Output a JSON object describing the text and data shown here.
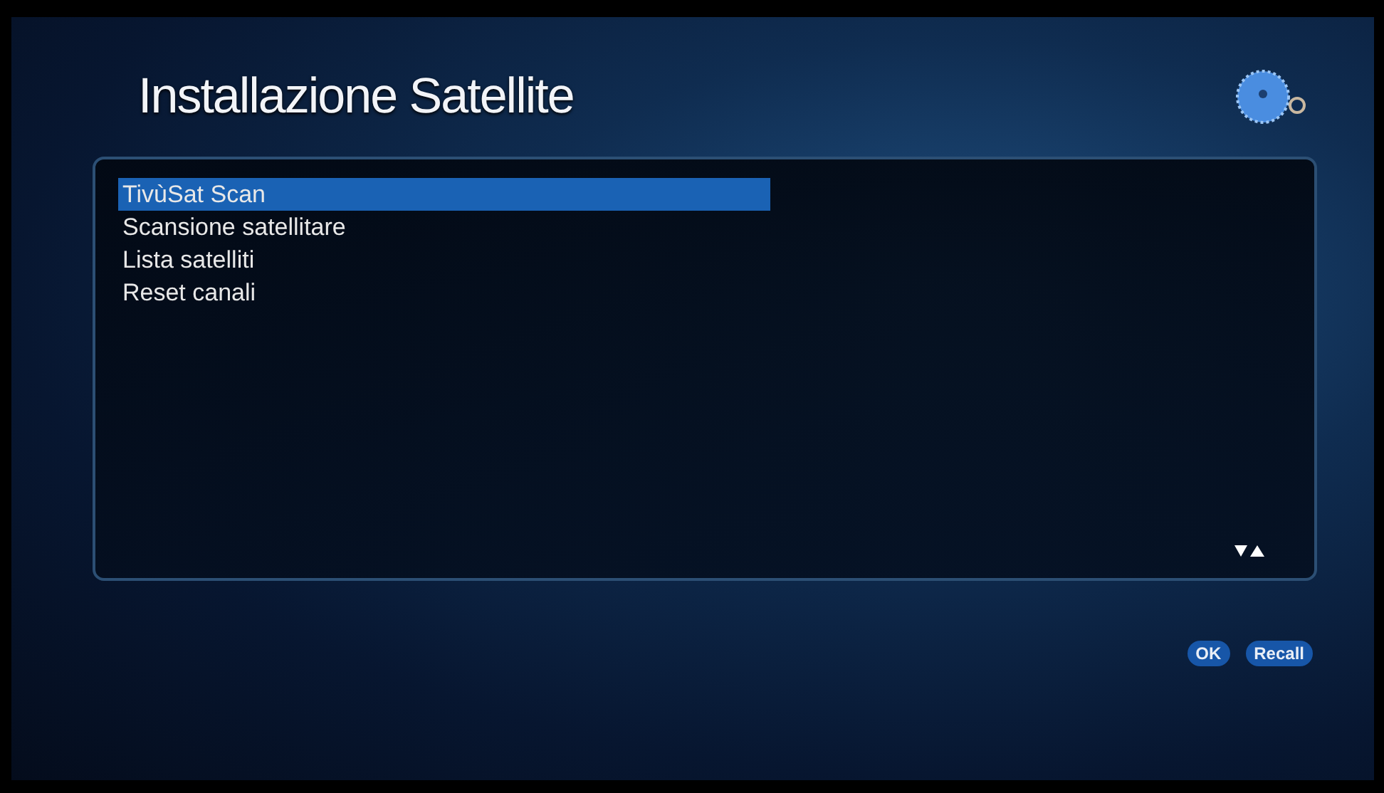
{
  "title": "Installazione Satellite",
  "menu": [
    {
      "label": "TivùSat Scan",
      "selected": true
    },
    {
      "label": "Scansione satellitare",
      "selected": false
    },
    {
      "label": "Lista satelliti",
      "selected": false
    },
    {
      "label": "Reset canali",
      "selected": false
    }
  ],
  "buttons": [
    "OK",
    "Recall"
  ]
}
